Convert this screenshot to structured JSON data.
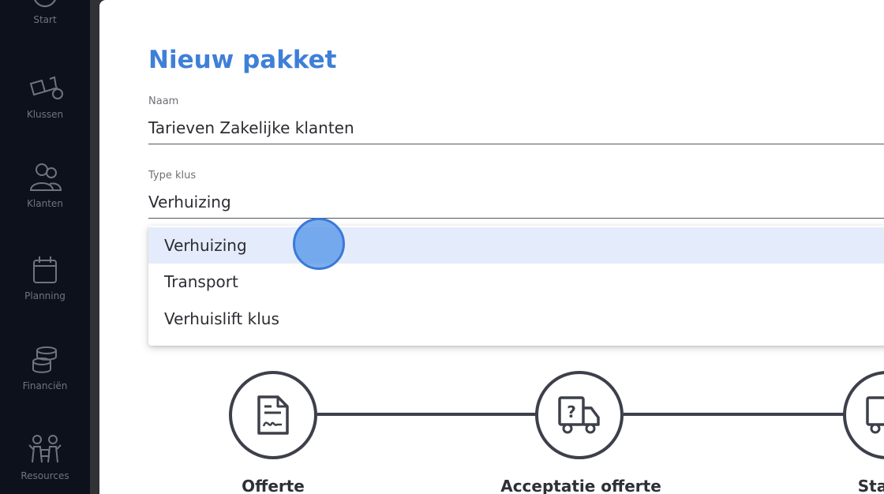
{
  "sidebar": {
    "items": [
      {
        "label": "Start",
        "icon": "gauge-icon"
      },
      {
        "label": "Klussen",
        "icon": "forklift-icon"
      },
      {
        "label": "Klanten",
        "icon": "customers-icon"
      },
      {
        "label": "Planning",
        "icon": "calendar-icon"
      },
      {
        "label": "Financiën",
        "icon": "coins-icon"
      },
      {
        "label": "Resources",
        "icon": "team-icon"
      }
    ]
  },
  "form": {
    "title": "Nieuw pakket",
    "name_label": "Naam",
    "name_value": "Tarieven Zakelijke klanten",
    "type_label": "Type klus",
    "type_value": "Verhuizing"
  },
  "dropdown": {
    "options": [
      "Verhuizing",
      "Transport",
      "Verhuislift klus"
    ],
    "selected_index": 0
  },
  "steps": [
    {
      "label": "Offerte",
      "icon": "document-icon"
    },
    {
      "label": "Acceptatie offerte",
      "icon": "truck-question-icon"
    },
    {
      "label": "Starte",
      "icon": "truck-icon"
    }
  ],
  "colors": {
    "sidebar_bg": "#0c111c",
    "accent": "#3f7fd8",
    "selected_option_bg": "#e4ecfb"
  }
}
